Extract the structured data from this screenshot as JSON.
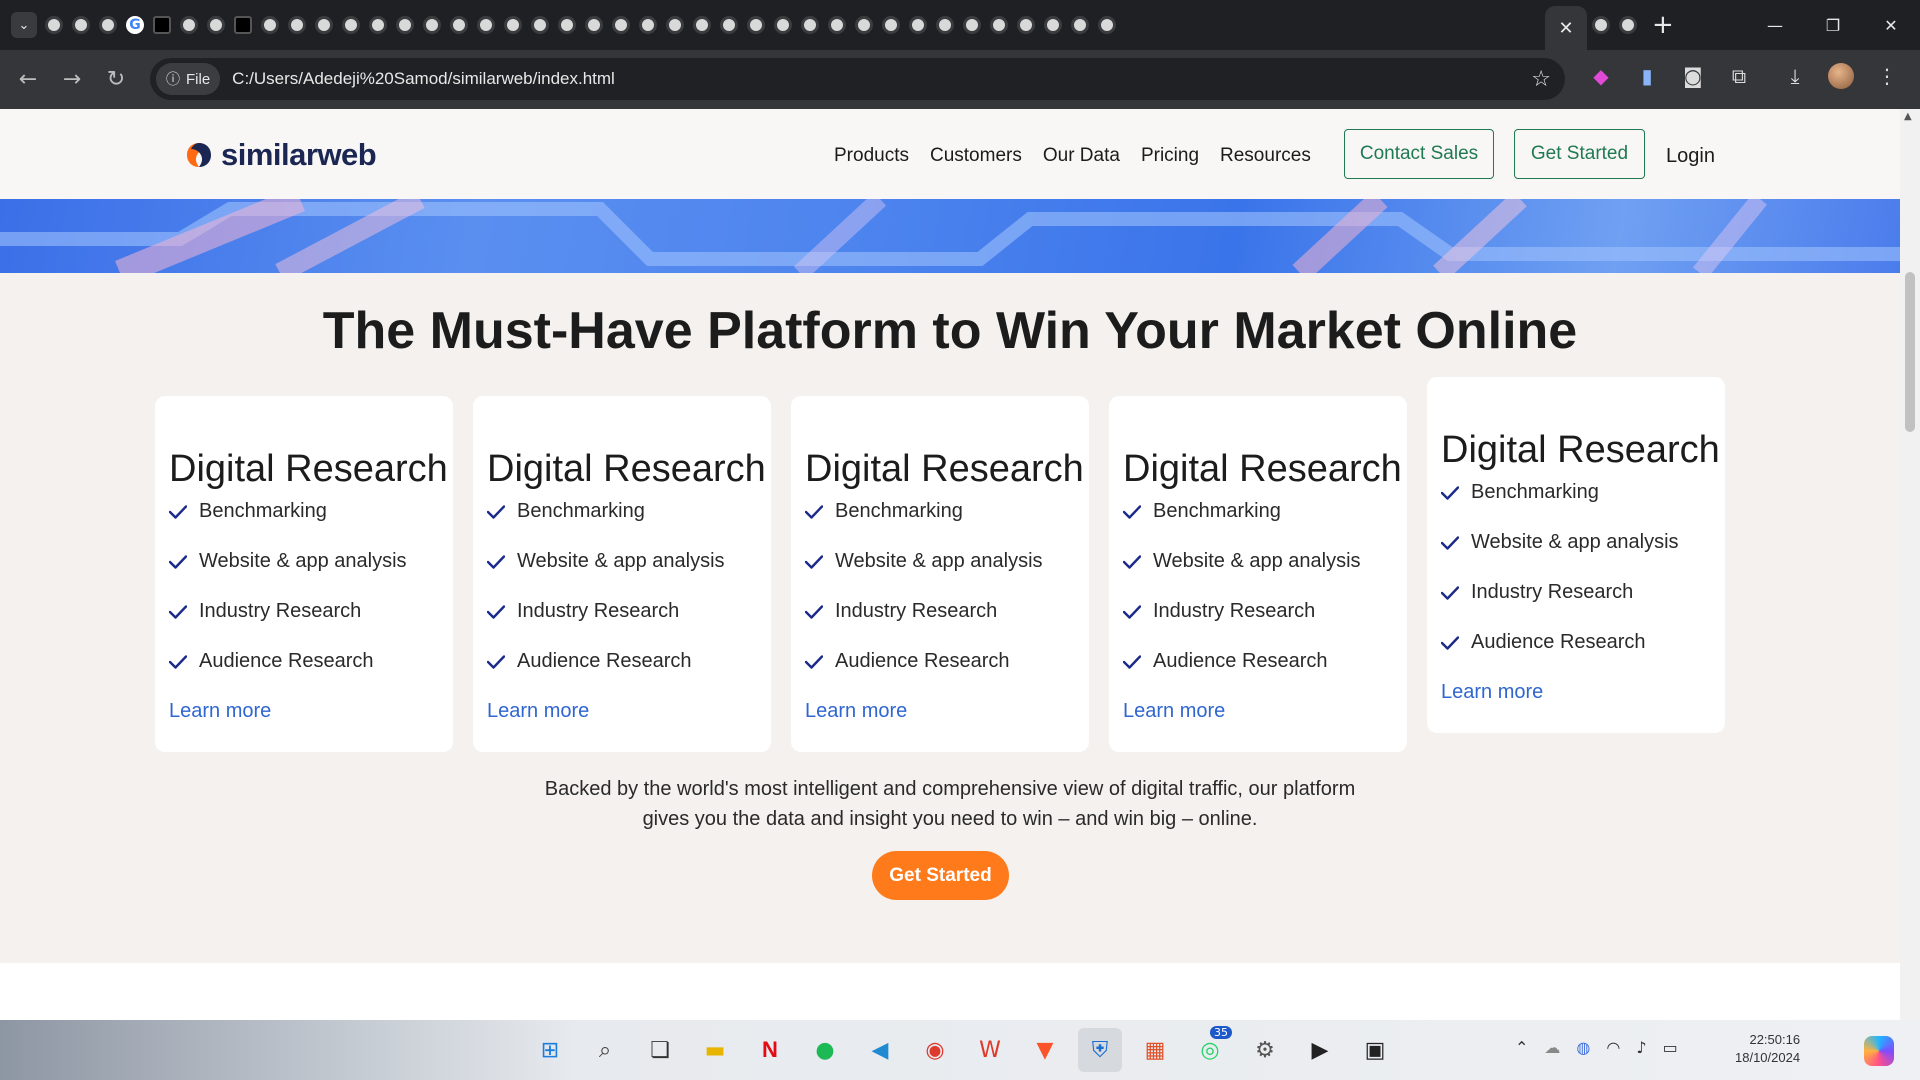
{
  "browser": {
    "url": "C:/Users/Adedeji%20Samod/similarweb/index.html",
    "site_chip_label": "File",
    "tab_count_icons": 40
  },
  "site": {
    "logo_text": "similarweb",
    "nav": [
      "Products",
      "Customers",
      "Our Data",
      "Pricing",
      "Resources"
    ],
    "contact_sales": "Contact Sales",
    "get_started_header": "Get Started",
    "login": "Login",
    "headline": "The Must-Have Platform to Win Your Market Online",
    "cards": [
      {
        "title": "Digital Research",
        "features": [
          "Benchmarking",
          "Website & app analysis",
          "Industry Research",
          "Audience Research"
        ],
        "link": "Learn more"
      },
      {
        "title": "Digital Research",
        "features": [
          "Benchmarking",
          "Website & app analysis",
          "Industry Research",
          "Audience Research"
        ],
        "link": "Learn more"
      },
      {
        "title": "Digital Research",
        "features": [
          "Benchmarking",
          "Website & app analysis",
          "Industry Research",
          "Audience Research"
        ],
        "link": "Learn more"
      },
      {
        "title": "Digital Research",
        "features": [
          "Benchmarking",
          "Website & app analysis",
          "Industry Research",
          "Audience Research"
        ],
        "link": "Learn more"
      },
      {
        "title": "Digital Research",
        "features": [
          "Benchmarking",
          "Website & app analysis",
          "Industry Research",
          "Audience Research"
        ],
        "link": "Learn more"
      }
    ],
    "tagline_line1": "Backed by the world's most intelligent and comprehensive view of digital traffic, our platform",
    "tagline_line2": "gives you the data and insight you need to win – and win big – online.",
    "cta": "Get Started",
    "colors": {
      "brand_green": "#1f7a52",
      "cta_orange": "#ff7a1a",
      "link_blue": "#2f66d0",
      "check_navy": "#1b2a8a"
    }
  },
  "taskbar": {
    "whatsapp_badge": "35",
    "time": "22:50:16",
    "date": "18/10/2024"
  }
}
